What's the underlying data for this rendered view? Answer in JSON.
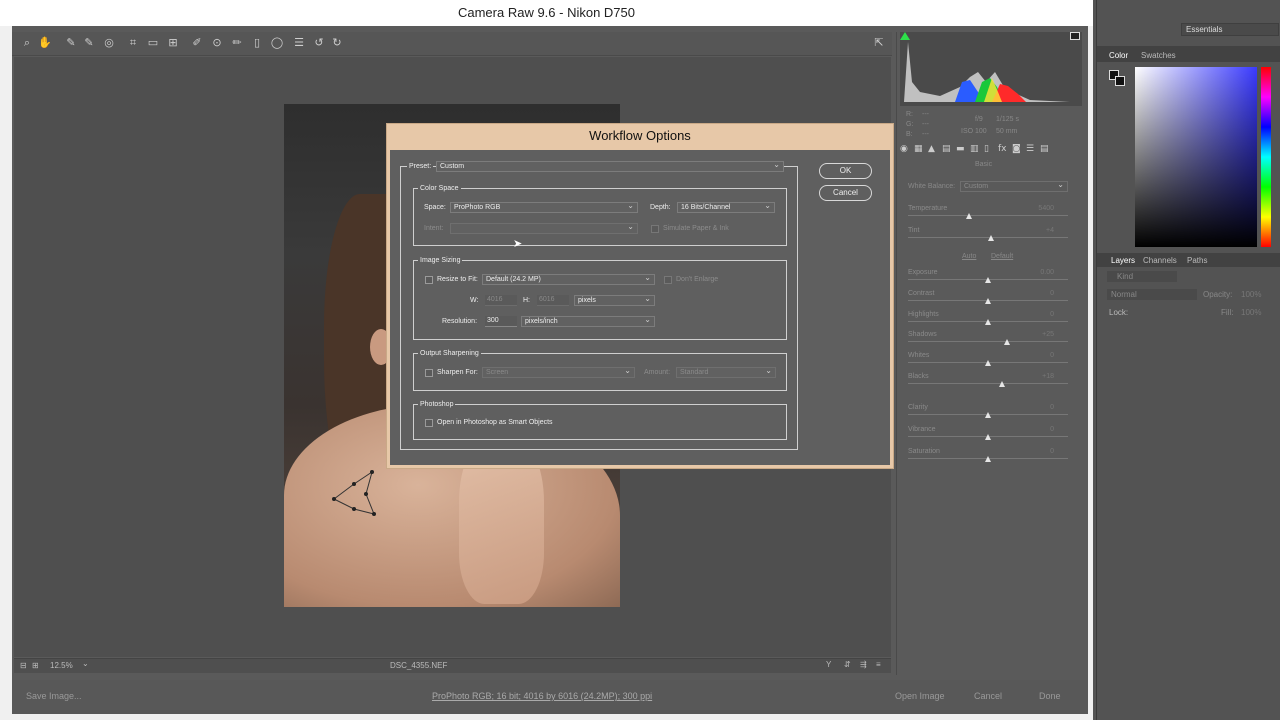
{
  "window": {
    "title": "Camera Raw 9.6  -  Nikon D750"
  },
  "dialog": {
    "title": "Workflow Options",
    "preset_label": "Preset:",
    "preset_value": "Custom",
    "ok_label": "OK",
    "cancel_label": "Cancel",
    "color_space": {
      "legend": "Color Space",
      "space_label": "Space:",
      "space_value": "ProPhoto RGB",
      "depth_label": "Depth:",
      "depth_value": "16 Bits/Channel",
      "intent_label": "Intent:",
      "intent_value": "",
      "simulate_label": "Simulate Paper & Ink"
    },
    "image_sizing": {
      "legend": "Image Sizing",
      "resize_label": "Resize to Fit:",
      "resize_value": "Default  (24.2 MP)",
      "dont_enlarge_label": "Don't Enlarge",
      "w_label": "W:",
      "w_value": "4016",
      "h_label": "H:",
      "h_value": "6016",
      "units_value": "pixels",
      "resolution_label": "Resolution:",
      "resolution_value": "300",
      "resolution_units": "pixels/inch"
    },
    "output_sharpening": {
      "legend": "Output Sharpening",
      "sharpen_label": "Sharpen For:",
      "sharpen_value": "Screen",
      "amount_label": "Amount:",
      "amount_value": "Standard"
    },
    "photoshop": {
      "legend": "Photoshop",
      "smart_objects_label": "Open in Photoshop as Smart Objects"
    }
  },
  "statusbar": {
    "zoom": "12.5%",
    "filename": "DSC_4355.NEF"
  },
  "bottombar": {
    "save_label": "Save Image...",
    "workflow_link": "ProPhoto RGB; 16 bit; 4016 by 6016 (24.2MP); 300 ppi",
    "open_label": "Open Image",
    "cancel_label": "Cancel",
    "done_label": "Done"
  },
  "panel": {
    "readout": {
      "r": "R:",
      "g": "G:",
      "b": "B:",
      "dash": "---",
      "aperture": "f/9",
      "shutter": "1/125 s",
      "iso": "ISO 100",
      "focal": "50 mm"
    },
    "section": "Basic",
    "wb_label": "White Balance:",
    "wb_value": "Custom",
    "auto": "Auto",
    "default": "Default",
    "sliders": [
      {
        "label": "Temperature",
        "value": "5400",
        "pos": 0.38
      },
      {
        "label": "Tint",
        "value": "+4",
        "pos": 0.52
      },
      {
        "label": "Exposure",
        "value": "0.00",
        "pos": 0.5
      },
      {
        "label": "Contrast",
        "value": "0",
        "pos": 0.5
      },
      {
        "label": "Highlights",
        "value": "0",
        "pos": 0.5
      },
      {
        "label": "Shadows",
        "value": "+25",
        "pos": 0.62
      },
      {
        "label": "Whites",
        "value": "0",
        "pos": 0.5
      },
      {
        "label": "Blacks",
        "value": "+18",
        "pos": 0.59
      },
      {
        "label": "Clarity",
        "value": "0",
        "pos": 0.5
      },
      {
        "label": "Vibrance",
        "value": "0",
        "pos": 0.5
      },
      {
        "label": "Saturation",
        "value": "0",
        "pos": 0.5
      }
    ]
  },
  "photoshop": {
    "workspace": "Essentials",
    "tab_color": "Color",
    "tab_swatches": "Swatches",
    "tab_layers": "Layers",
    "tab_channels": "Channels",
    "tab_paths": "Paths",
    "kind": "Kind",
    "blend": "Normal",
    "opacity_label": "Opacity:",
    "opacity_value": "100%",
    "lock_label": "Lock:",
    "fill_label": "Fill:",
    "fill_value": "100%"
  }
}
